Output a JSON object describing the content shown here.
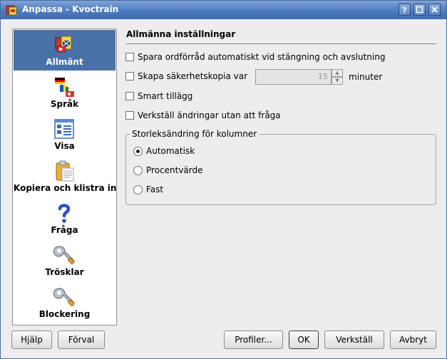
{
  "window": {
    "title": "Anpassa - Kvoctrain",
    "buttons": {
      "help": "?",
      "maximize": "□",
      "close": "✕"
    }
  },
  "sidebar": {
    "items": [
      {
        "label": "Allmänt",
        "icon": "general-flags-icon",
        "selected": true
      },
      {
        "label": "Språk",
        "icon": "language-flags-icon",
        "selected": false
      },
      {
        "label": "Visa",
        "icon": "view-list-icon",
        "selected": false
      },
      {
        "label": "Kopiera och klistra in",
        "icon": "clipboard-icon",
        "selected": false
      },
      {
        "label": "Fråga",
        "icon": "question-icon",
        "selected": false
      },
      {
        "label": "Trösklar",
        "icon": "wrench-icon",
        "selected": false
      },
      {
        "label": "Blockering",
        "icon": "wrench-icon",
        "selected": false
      }
    ]
  },
  "main": {
    "heading": "Allmänna inställningar",
    "options": {
      "autosave": {
        "label": "Spara ordförråd automatiskt vid stängning och avslutning",
        "checked": false
      },
      "backup": {
        "label": "Skapa säkerhetskopia var",
        "checked": false,
        "value": "15",
        "unit": "minuter"
      },
      "smart_append": {
        "label": "Smart tillägg",
        "checked": false
      },
      "apply_without_asking": {
        "label": "Verkställ ändringar utan att fråga",
        "checked": false
      }
    },
    "resize_group": {
      "title": "Storleksändring för kolumner",
      "options": [
        {
          "label": "Automatisk",
          "selected": true
        },
        {
          "label": "Procentvärde",
          "selected": false
        },
        {
          "label": "Fast",
          "selected": false
        }
      ]
    }
  },
  "footer": {
    "help": "Hjälp",
    "defaults": "Förval",
    "profiles": "Profiler...",
    "ok": "OK",
    "apply": "Verkställ",
    "cancel": "Avbryt"
  },
  "colors": {
    "titlebar": "#4d7bc0",
    "selection": "#4a70a8",
    "dialog_bg": "#ededed"
  }
}
